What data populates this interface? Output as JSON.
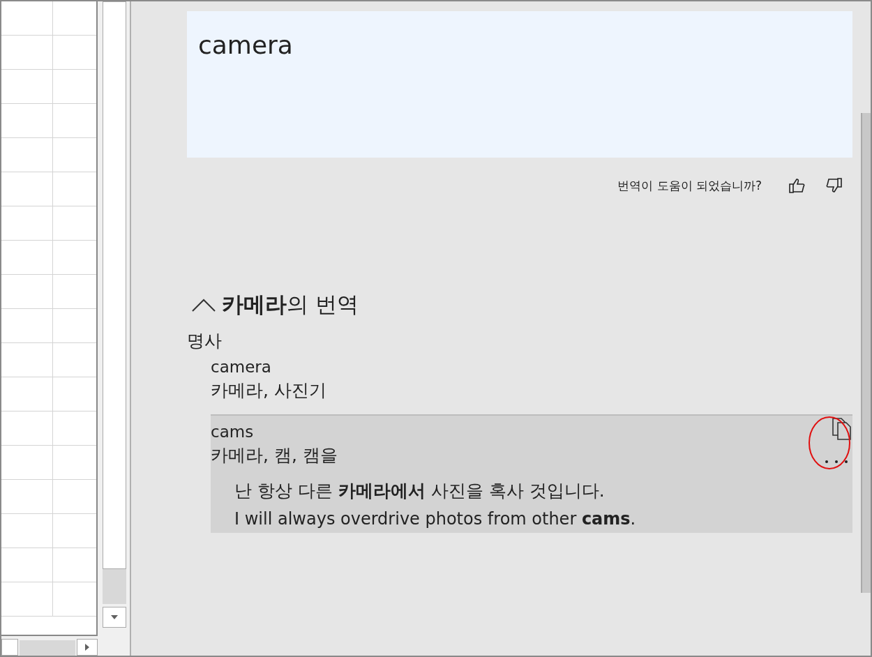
{
  "source_text": "camera",
  "feedback": {
    "question": "번역이 도움이 되었습니까?"
  },
  "dictionary": {
    "heading": "**카메라**의 번역",
    "expanded": true,
    "part_of_speech": "명사",
    "entries": [
      {
        "term": "camera",
        "translations": "카메라, 사진기",
        "selected": false
      },
      {
        "term": "cams",
        "translations": "카메라, 캠, 캠을",
        "selected": true,
        "example": {
          "korean": "난 항상 다른 **카메라에서** 사진을 혹사 것입니다.",
          "english": "I will always overdrive photos from other **cams**."
        }
      }
    ]
  }
}
